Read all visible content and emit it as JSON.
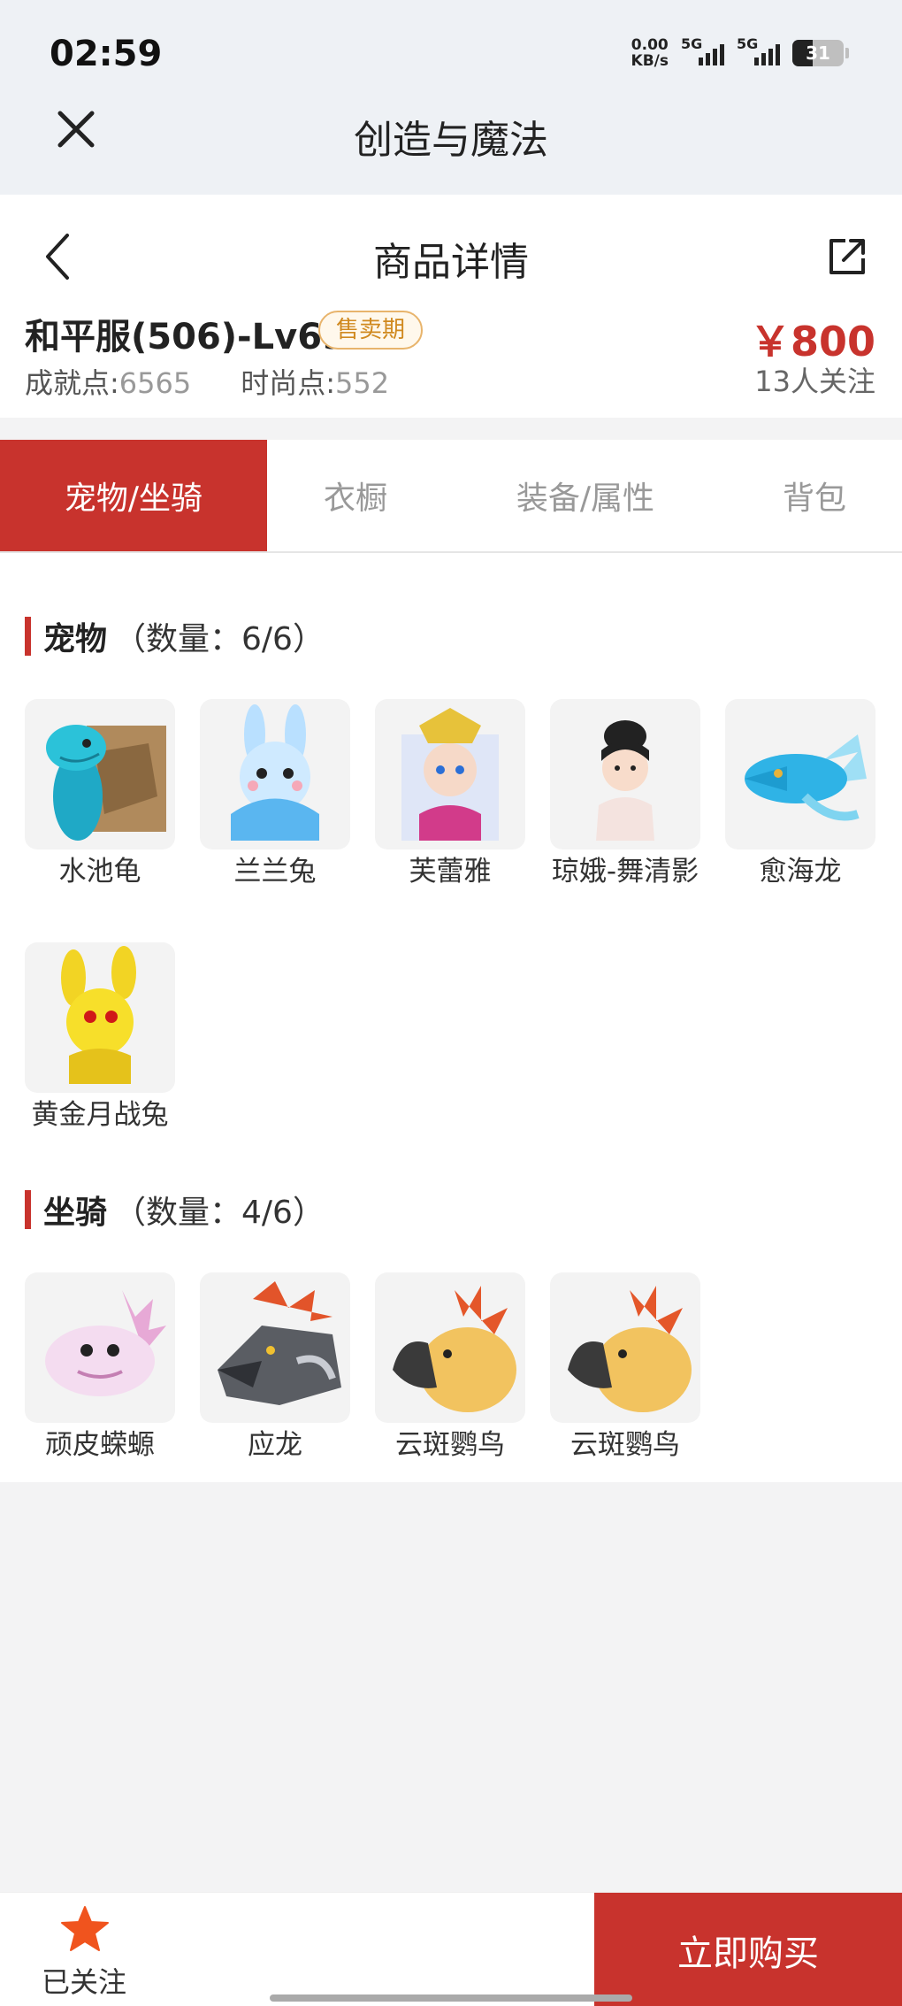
{
  "status_bar": {
    "time": "02:59",
    "net_speed_value": "0.00",
    "net_speed_unit": "KB/s",
    "sim1": "5G",
    "sim2": "5G",
    "battery": "31"
  },
  "app_bar": {
    "title": "创造与魔法",
    "close_icon": "close-icon"
  },
  "detail": {
    "title": "商品详情",
    "server": "和平服(506)-Lv69",
    "status": "售卖期",
    "achievement_label": "成就点:",
    "achievement_value": "6565",
    "fashion_label": "时尚点:",
    "fashion_value": "552",
    "price": "￥800",
    "followers": "13人关注"
  },
  "tabs": [
    {
      "label": "宠物/坐骑",
      "active": true
    },
    {
      "label": "衣橱",
      "active": false
    },
    {
      "label": "装备/属性",
      "active": false
    },
    {
      "label": "背包",
      "active": false
    }
  ],
  "pets": {
    "label": "宠物",
    "count": "（数量：6/6）",
    "items": [
      {
        "name": "水池龟"
      },
      {
        "name": "兰兰兔"
      },
      {
        "name": "芙蕾雅"
      },
      {
        "name": "琼娥-舞清影"
      },
      {
        "name": "愈海龙"
      },
      {
        "name": "黄金月战兔"
      }
    ]
  },
  "mounts": {
    "label": "坐骑",
    "count": "（数量：4/6）",
    "items": [
      {
        "name": "顽皮蝾螈"
      },
      {
        "name": "应龙"
      },
      {
        "name": "云斑鹦鸟"
      },
      {
        "name": "云斑鹦鸟"
      }
    ]
  },
  "bottom": {
    "follow_label": "已关注",
    "buy_label": "立即购买"
  },
  "colors": {
    "accent": "#c8332d",
    "badge": "#d0891f",
    "star": "#f0541e"
  }
}
